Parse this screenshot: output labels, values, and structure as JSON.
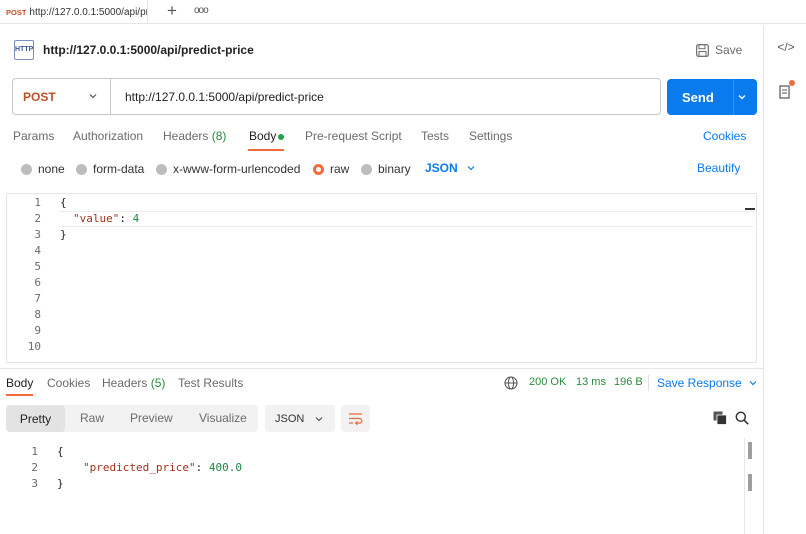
{
  "tab": {
    "method": "POST",
    "url": "http://127.0.0.1:5000/api/predict-price"
  },
  "request": {
    "icon_text": "HTTP",
    "title": "http://127.0.0.1:5000/api/predict-price",
    "save_label": "Save",
    "method": "POST",
    "url": "http://127.0.0.1:5000/api/predict-price",
    "send_label": "Send"
  },
  "request_tabs": {
    "params": "Params",
    "authorization": "Authorization",
    "headers": "Headers",
    "headers_count": "(8)",
    "body": "Body",
    "pre_request": "Pre-request Script",
    "tests": "Tests",
    "settings": "Settings",
    "cookies": "Cookies"
  },
  "body_types": {
    "none": "none",
    "form_data": "form-data",
    "urlencoded": "x-www-form-urlencoded",
    "raw": "raw",
    "binary": "binary",
    "format": "JSON",
    "beautify": "Beautify"
  },
  "editor": {
    "line_numbers": [
      "1",
      "2",
      "3",
      "4",
      "5",
      "6",
      "7",
      "8",
      "9",
      "10"
    ],
    "open_brace": "{",
    "key": "\"value\"",
    "colon": ": ",
    "value": "4",
    "close_brace": "}"
  },
  "response_tabs": {
    "body": "Body",
    "cookies": "Cookies",
    "headers": "Headers",
    "headers_count": "(5)",
    "test_results": "Test Results"
  },
  "response_meta": {
    "status": "200 OK",
    "time": "13 ms",
    "size": "196 B",
    "save_response": "Save Response"
  },
  "response_view": {
    "pretty": "Pretty",
    "raw": "Raw",
    "preview": "Preview",
    "visualize": "Visualize",
    "format": "JSON"
  },
  "response_body": {
    "line_numbers": [
      "1",
      "2",
      "3"
    ],
    "open_brace": "{",
    "key": "\"predicted_price\"",
    "colon": ": ",
    "value": "400.0",
    "close_brace": "}"
  },
  "colors": {
    "accent": "#097bed",
    "method_post": "#c0502b",
    "orange": "#f26b3a",
    "success": "#2a8a3e"
  }
}
